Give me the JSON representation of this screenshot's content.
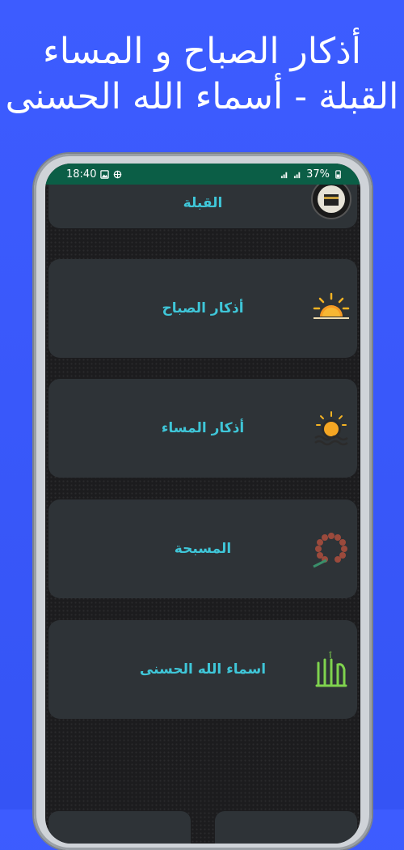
{
  "promo": {
    "line1": "أذكار الصباح و المساء",
    "line2": "القبلة - أسماء الله الحسنى"
  },
  "status_bar": {
    "time": "18:40",
    "battery": "37%"
  },
  "menu": {
    "items": [
      {
        "label": "القبلة",
        "icon": "kaaba-icon"
      },
      {
        "label": "أذكار الصباح",
        "icon": "sunrise-icon"
      },
      {
        "label": "أذكار المساء",
        "icon": "sunset-icon"
      },
      {
        "label": "المسبحة",
        "icon": "prayer-beads-icon"
      },
      {
        "label": "اسماء الله الحسنى",
        "icon": "allah-calligraphy-icon"
      }
    ]
  },
  "colors": {
    "background": "#3d5cff",
    "status_bar": "#0b5e46",
    "card": "#2e3337",
    "label": "#3fc6d8"
  }
}
